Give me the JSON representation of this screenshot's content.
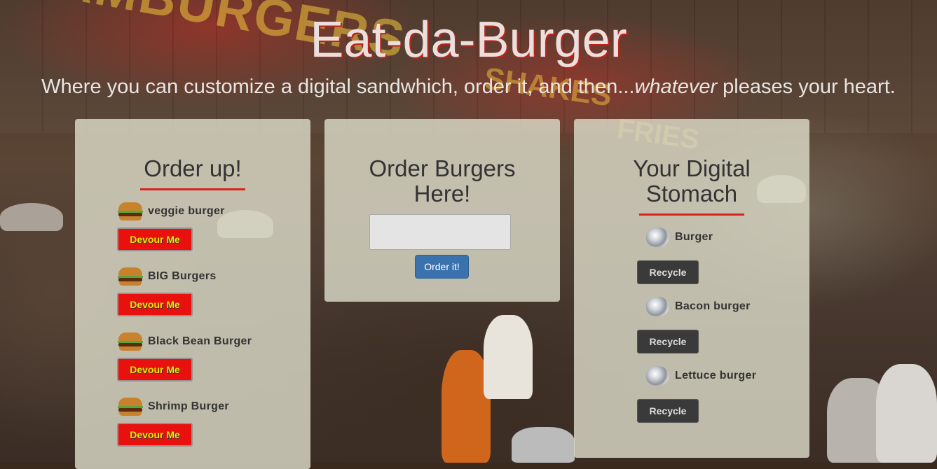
{
  "header": {
    "title": "Eat-da-Burger",
    "subtitle_before": "Where you can customize a digital sandwhich, order it, and then...",
    "subtitle_em": "whatever",
    "subtitle_after": " pleases your heart."
  },
  "order_up": {
    "heading": "Order up!",
    "items": [
      {
        "name": "veggie burger",
        "button": "Devour Me",
        "icon": "burger-icon"
      },
      {
        "name": "BIG Burgers",
        "button": "Devour Me",
        "icon": "burger-icon"
      },
      {
        "name": "Black Bean Burger",
        "button": "Devour Me",
        "icon": "burger-icon"
      },
      {
        "name": "Shrimp Burger",
        "button": "Devour Me",
        "icon": "burger-icon"
      }
    ]
  },
  "order_form": {
    "heading_line1": "Order Burgers",
    "heading_line2": "Here!",
    "input_value": "",
    "submit_label": "Order it!"
  },
  "stomach": {
    "heading_line1": "Your Digital",
    "heading_line2": "Stomach",
    "items": [
      {
        "name": "Burger",
        "button": "Recycle",
        "icon": "foil-wrapper-icon"
      },
      {
        "name": "Bacon burger",
        "button": "Recycle",
        "icon": "foil-wrapper-icon"
      },
      {
        "name": "Lettuce burger",
        "button": "Recycle",
        "icon": "foil-wrapper-icon"
      }
    ]
  },
  "colors": {
    "accent_red": "#d8241b",
    "devour_bg": "#e8110e",
    "devour_text": "#f7e400",
    "order_button": "#3a72ad",
    "recycle_button": "#3a3a3a"
  }
}
